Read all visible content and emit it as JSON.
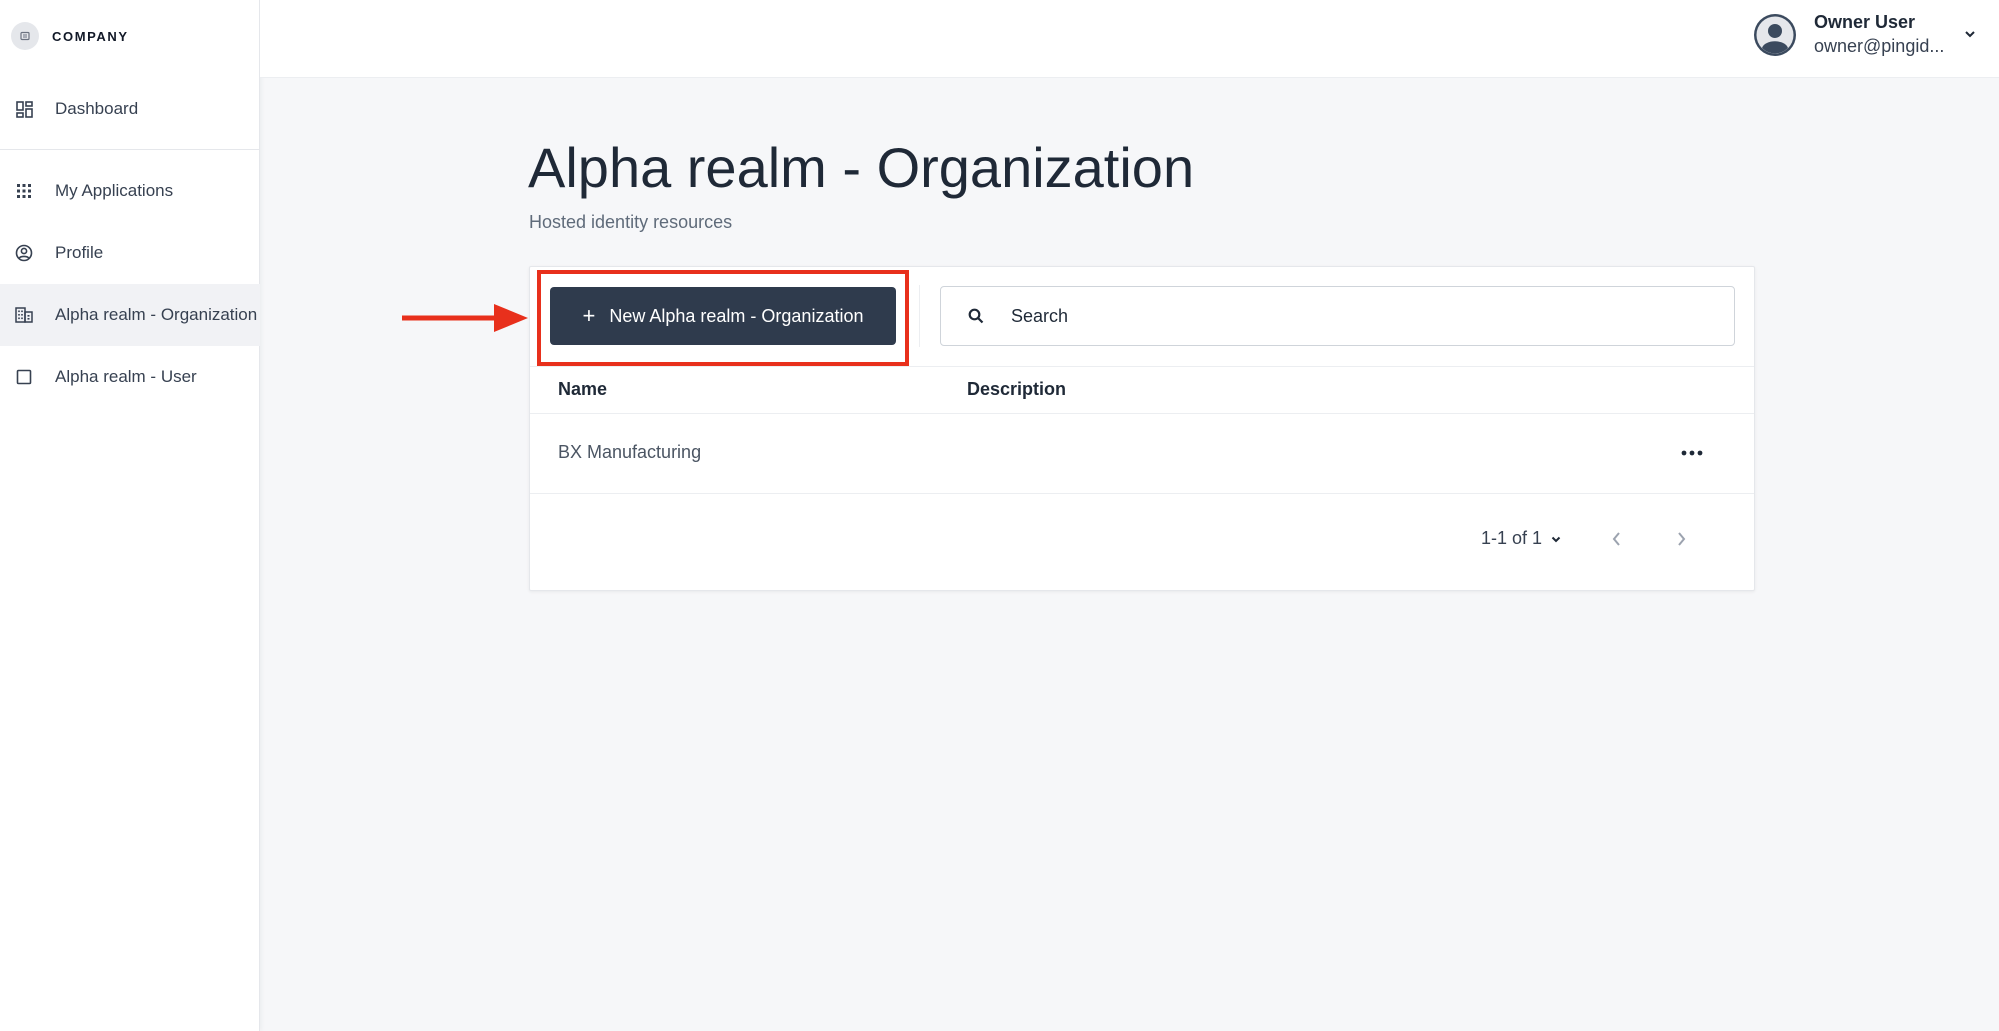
{
  "brand": {
    "name": "COMPANY",
    "icon": "company-logo-icon"
  },
  "sidebar": {
    "items": [
      {
        "label": "Dashboard",
        "icon": "dashboard-icon"
      },
      {
        "label": "My Applications",
        "icon": "apps-grid-icon"
      },
      {
        "label": "Profile",
        "icon": "user-circle-icon"
      },
      {
        "label": "Alpha realm - Organization",
        "icon": "building-icon",
        "active": true
      },
      {
        "label": "Alpha realm - User",
        "icon": "square-icon"
      }
    ]
  },
  "header": {
    "user_name": "Owner User",
    "user_email": "owner@pingid..."
  },
  "main": {
    "title": "Alpha realm - Organization",
    "subtitle": "Hosted identity resources",
    "new_button_label": "New Alpha realm - Organization",
    "search_placeholder": "Search",
    "table": {
      "columns": [
        "Name",
        "Description"
      ],
      "rows": [
        {
          "name": "BX Manufacturing",
          "description": ""
        }
      ]
    },
    "pagination": {
      "range_label": "1-1 of 1"
    }
  },
  "colors": {
    "primary_button": "#2f3b4d",
    "highlight": "#e8301c",
    "sidebar_active": "#f1f2f5",
    "background": "#f6f7f9"
  }
}
